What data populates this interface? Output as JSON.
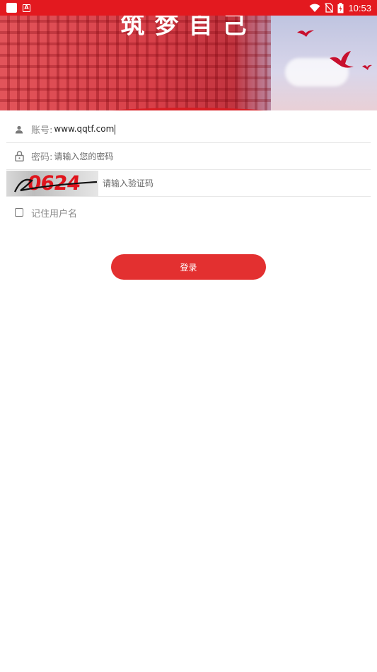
{
  "status_bar": {
    "time": "10:53",
    "left_icons": [
      "app-icon",
      "a-icon"
    ],
    "right_icons": [
      "wifi-icon",
      "no-sim-icon",
      "battery-charging-icon"
    ]
  },
  "banner": {
    "title": "筑梦自己"
  },
  "form": {
    "account_label": "账号:",
    "account_value": "www.qqtf.com",
    "password_label": "密码:",
    "password_placeholder": "请输入您的密码",
    "captcha_code": "0624",
    "captcha_placeholder": "请输入验证码",
    "remember_label": "记住用户名",
    "remember_checked": false,
    "login_label": "登录"
  },
  "colors": {
    "accent": "#e33030",
    "status_bar": "#e3191f"
  }
}
